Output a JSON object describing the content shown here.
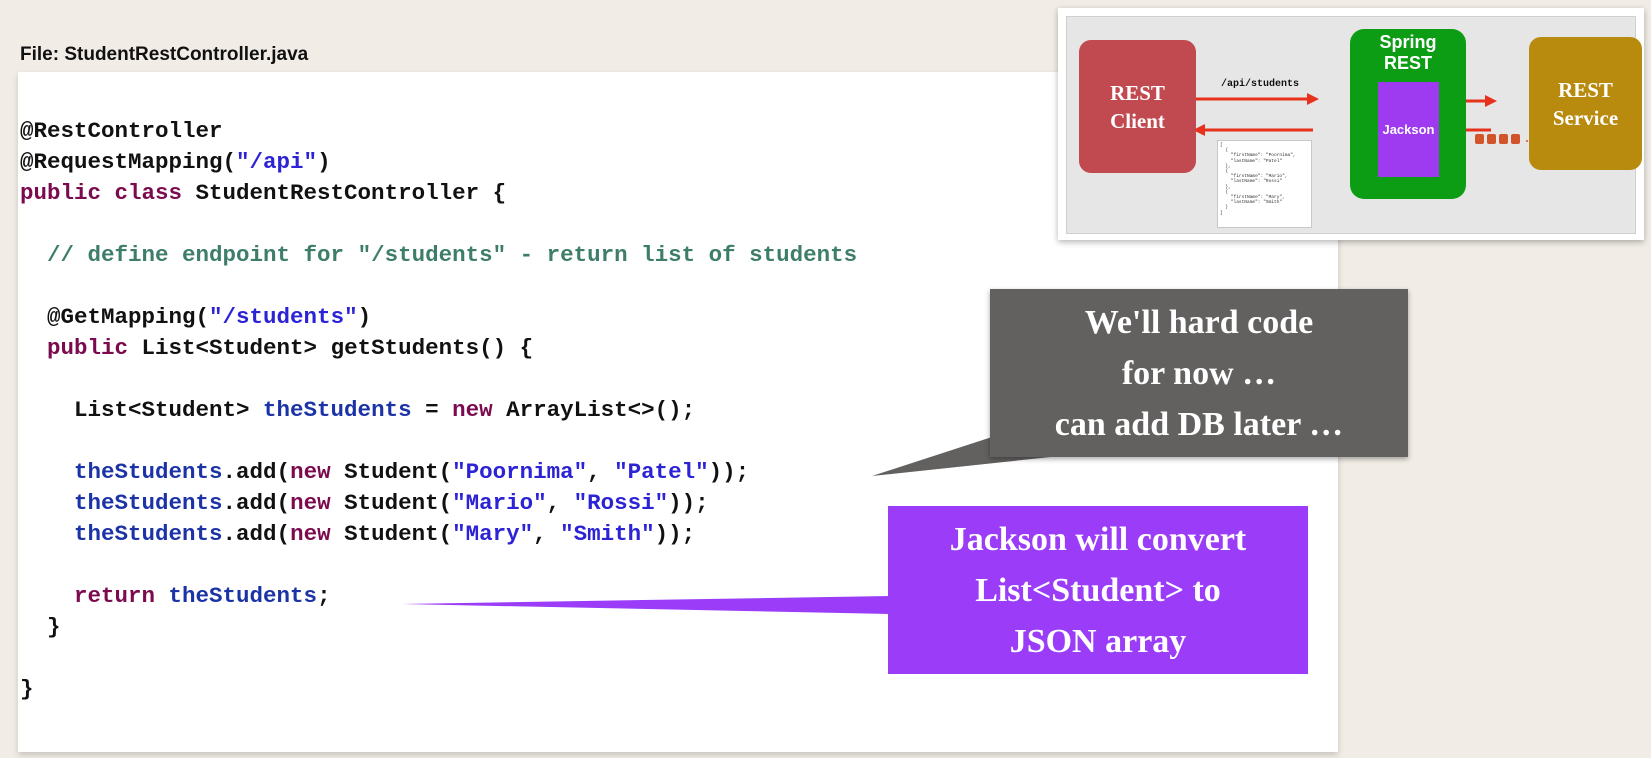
{
  "file_label": "File: StudentRestController.java",
  "code": {
    "line1": "@RestController",
    "line2_a": "@RequestMapping(",
    "line2_s": "\"/api\"",
    "line2_b": ")",
    "line3_kw": "public class",
    "line3_b": " StudentRestController {",
    "comment": "// define endpoint for \"/students\" - return list of students",
    "get_a": "@GetMapping(",
    "get_s": "\"/students\"",
    "get_b": ")",
    "method_kw": "public",
    "method_b": " List<Student> getStudents() {",
    "list_a": "List<Student> ",
    "list_var": "theStudents",
    "list_b": " = ",
    "list_kw": "new",
    "list_c": " ArrayList<>();",
    "add_var": "theStudents",
    "add_a": ".add(",
    "add_kw": "new",
    "add_b": " Student(",
    "add_sep": ", ",
    "add_end": "));",
    "students": [
      {
        "first": "\"Poornima\"",
        "last": "\"Patel\""
      },
      {
        "first": "\"Mario\"",
        "last": "\"Rossi\""
      },
      {
        "first": "\"Mary\"",
        "last": "\"Smith\""
      }
    ],
    "return_kw": "return",
    "return_var": " theStudents",
    "return_end": ";",
    "close_method": "}",
    "close_class": "}"
  },
  "diagram": {
    "client_line1": "REST",
    "client_line2": "Client",
    "spring_line1": "Spring",
    "spring_line2": "REST",
    "jackson": "Jackson",
    "service_line1": "REST",
    "service_line2": "Service",
    "api_path": "/api/students",
    "json_preview": "[\n  {\n    \"firstName\": \"Poornima\",\n    \"lastName\": \"Patel\"\n  },\n  {\n    \"firstName\": \"Mario\",\n    \"lastName\": \"Rossi\"\n  },\n  {\n    \"firstName\": \"Mary\",\n    \"lastName\": \"Smith\"\n  }\n]",
    "colors": {
      "client": "#c04a4f",
      "spring": "#0c9d15",
      "jackson": "#9e3bf0",
      "service": "#b88a0d",
      "arrow": "#e8311c"
    }
  },
  "callout_grey": {
    "line1": "We'll hard code",
    "line2": "for now …",
    "line3": "can add DB later …",
    "color": "#626160"
  },
  "callout_purple": {
    "line1": "Jackson will convert",
    "line2": "List<Student> to",
    "line3": "JSON array",
    "color": "#9a3cf8"
  }
}
